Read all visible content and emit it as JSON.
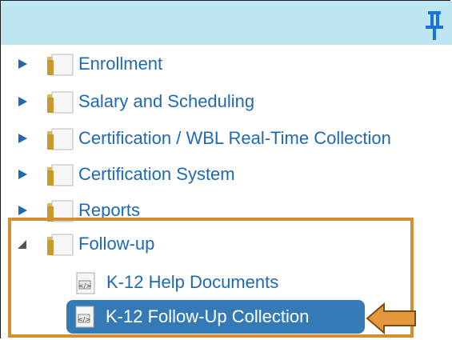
{
  "tree": {
    "items": [
      {
        "label": "Enrollment",
        "expanded": false
      },
      {
        "label": "Salary and Scheduling",
        "expanded": false
      },
      {
        "label": "Certification / WBL Real-Time Collection",
        "expanded": false
      },
      {
        "label": "Certification System",
        "expanded": false
      },
      {
        "label": "Reports",
        "expanded": false
      },
      {
        "label": "Follow-up",
        "expanded": true,
        "children": [
          {
            "label": "K-12 Help Documents",
            "selected": false
          },
          {
            "label": "K-12 Follow-Up Collection",
            "selected": true
          }
        ]
      }
    ]
  },
  "colors": {
    "header_bg": "#bde6f2",
    "link": "#1f69b4",
    "selected_bg": "#337ab7",
    "callout": "#d38f30",
    "expander": "#1f69b4"
  },
  "icons": {
    "pin": "pin-icon",
    "folder": "folder-icon",
    "document": "document-icon",
    "expand": "triangle-right-icon",
    "collapse": "triangle-down-icon"
  }
}
